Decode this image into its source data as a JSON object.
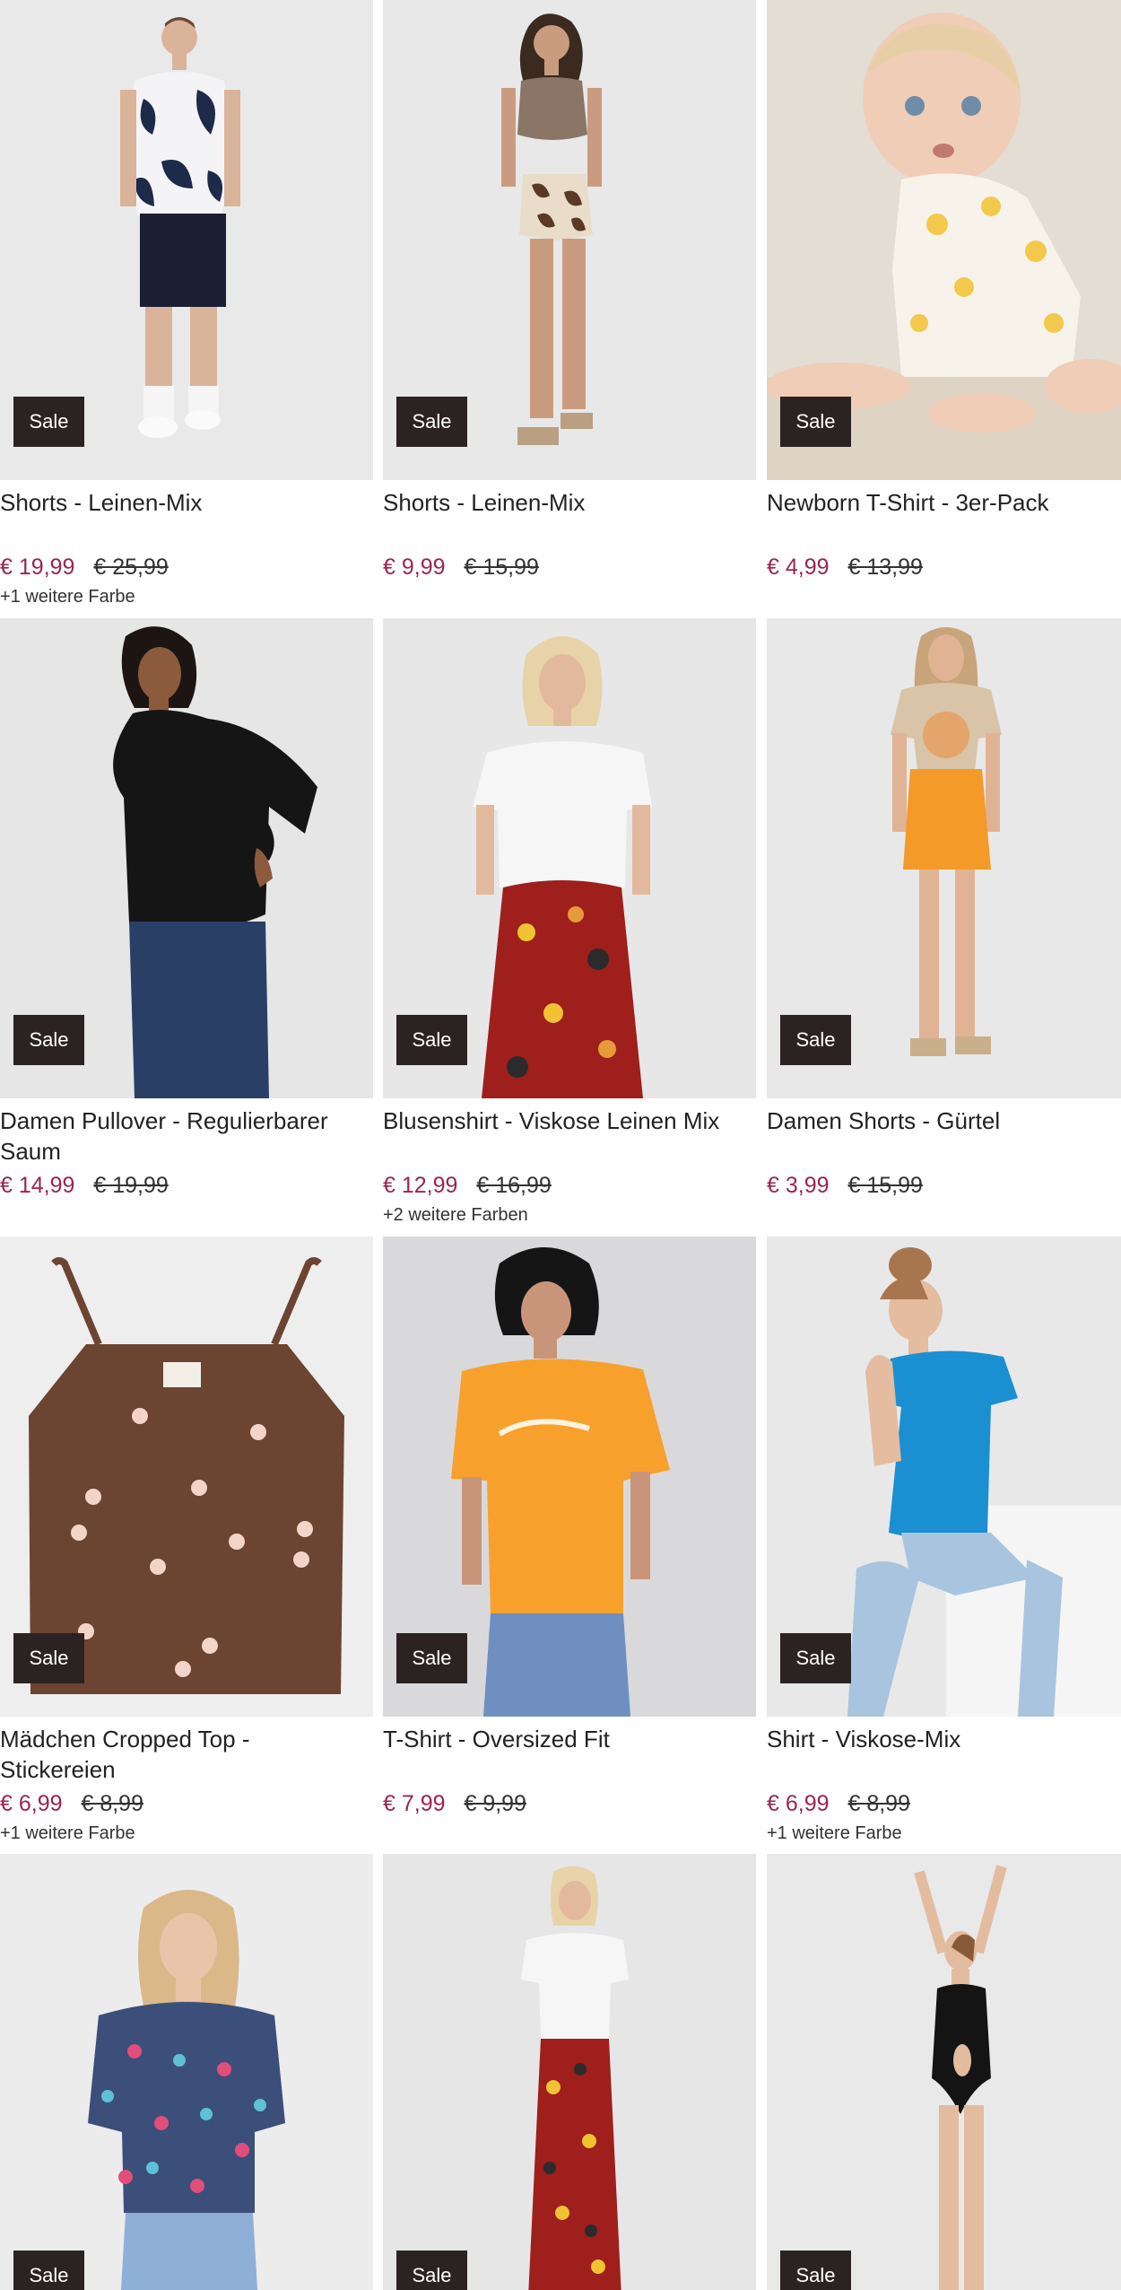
{
  "badge_label": "Sale",
  "products": [
    {
      "title": "Shorts - Leinen-Mix",
      "price_sale": "€ 19,99",
      "price_old": "€ 25,99",
      "colors": "+1 weitere Farbe",
      "image": "man-floral-shirt-navy-shorts"
    },
    {
      "title": "Shorts - Leinen-Mix",
      "price_sale": "€ 9,99",
      "price_old": "€ 15,99",
      "colors": "",
      "image": "woman-brown-top-paisley-shorts"
    },
    {
      "title": "Newborn T-Shirt - 3er-Pack",
      "price_sale": "€ 4,99",
      "price_old": "€ 13,99",
      "colors": "",
      "image": "baby-floral-tshirt"
    },
    {
      "title": "Damen Pullover - Regulierbarer Saum",
      "price_sale": "€ 14,99",
      "price_old": "€ 19,99",
      "colors": "",
      "image": "woman-black-pullover-jeans"
    },
    {
      "title": "Blusenshirt - Viskose Leinen Mix",
      "price_sale": "€ 12,99",
      "price_old": "€ 16,99",
      "colors": "+2 weitere Farben",
      "image": "woman-white-blouse-red-pants"
    },
    {
      "title": "Damen Shorts - Gürtel",
      "price_sale": "€ 3,99",
      "price_old": "€ 15,99",
      "colors": "",
      "image": "woman-orange-shorts"
    },
    {
      "title": "Mädchen Cropped Top - Stickereien",
      "price_sale": "€ 6,99",
      "price_old": "€ 8,99",
      "colors": "+1 weitere Farbe",
      "image": "brown-cropped-top-flowers"
    },
    {
      "title": "T-Shirt - Oversized Fit",
      "price_sale": "€ 7,99",
      "price_old": "€ 9,99",
      "colors": "",
      "image": "woman-orange-tshirt"
    },
    {
      "title": "Shirt - Viskose-Mix",
      "price_sale": "€ 6,99",
      "price_old": "€ 8,99",
      "colors": "+1 weitere Farbe",
      "image": "woman-blue-shirt-sitting"
    },
    {
      "title": "",
      "price_sale": "",
      "price_old": "",
      "colors": "",
      "image": "woman-floral-blouse"
    },
    {
      "title": "",
      "price_sale": "",
      "price_old": "",
      "colors": "",
      "image": "woman-white-shirt-red-pants"
    },
    {
      "title": "",
      "price_sale": "",
      "price_old": "",
      "colors": "",
      "image": "woman-black-swimsuit"
    }
  ]
}
